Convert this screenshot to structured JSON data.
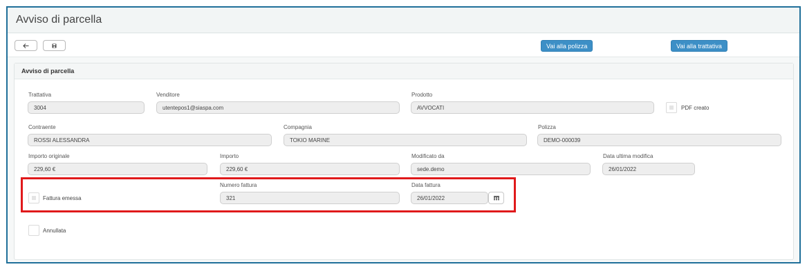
{
  "header": {
    "title": "Avviso di parcella"
  },
  "toolbar": {
    "back_icon": "arrow-left-icon",
    "save_icon": "save-icon",
    "goto_policy_label": "Vai alla polizza",
    "goto_deal_label": "Vai alla trattativa",
    "button_color": "#3d8fc6"
  },
  "panel": {
    "title": "Avviso di parcella",
    "fields": {
      "trattativa": {
        "label": "Trattativa",
        "value": "3004"
      },
      "venditore": {
        "label": "Venditore",
        "value": "utentepos1@siaspa.com"
      },
      "prodotto": {
        "label": "Prodotto",
        "value": "AVVOCATI"
      },
      "pdf_creato": {
        "label": "PDF creato",
        "checked": false
      },
      "contraente": {
        "label": "Contraente",
        "value": "ROSSI ALESSANDRA"
      },
      "compagnia": {
        "label": "Compagnia",
        "value": "TOKIO MARINE"
      },
      "polizza": {
        "label": "Polizza",
        "value": "DEMO-000039"
      },
      "importo_originale": {
        "label": "Importo originale",
        "value": "229,60 €"
      },
      "importo": {
        "label": "Importo",
        "value": "229,60 €"
      },
      "modificato_da": {
        "label": "Modificato da",
        "value": "sede.demo"
      },
      "data_ultima_modifica": {
        "label": "Data ultima modifica",
        "value": "26/01/2022"
      },
      "fattura_emessa": {
        "label": "Fattura emessa",
        "checked": false
      },
      "numero_fattura": {
        "label": "Numero fattura",
        "value": "321"
      },
      "data_fattura": {
        "label": "Data fattura",
        "value": "26/01/2022"
      },
      "annullata": {
        "label": "Annullata",
        "checked": false
      }
    }
  },
  "highlight_color": "#e0191b"
}
